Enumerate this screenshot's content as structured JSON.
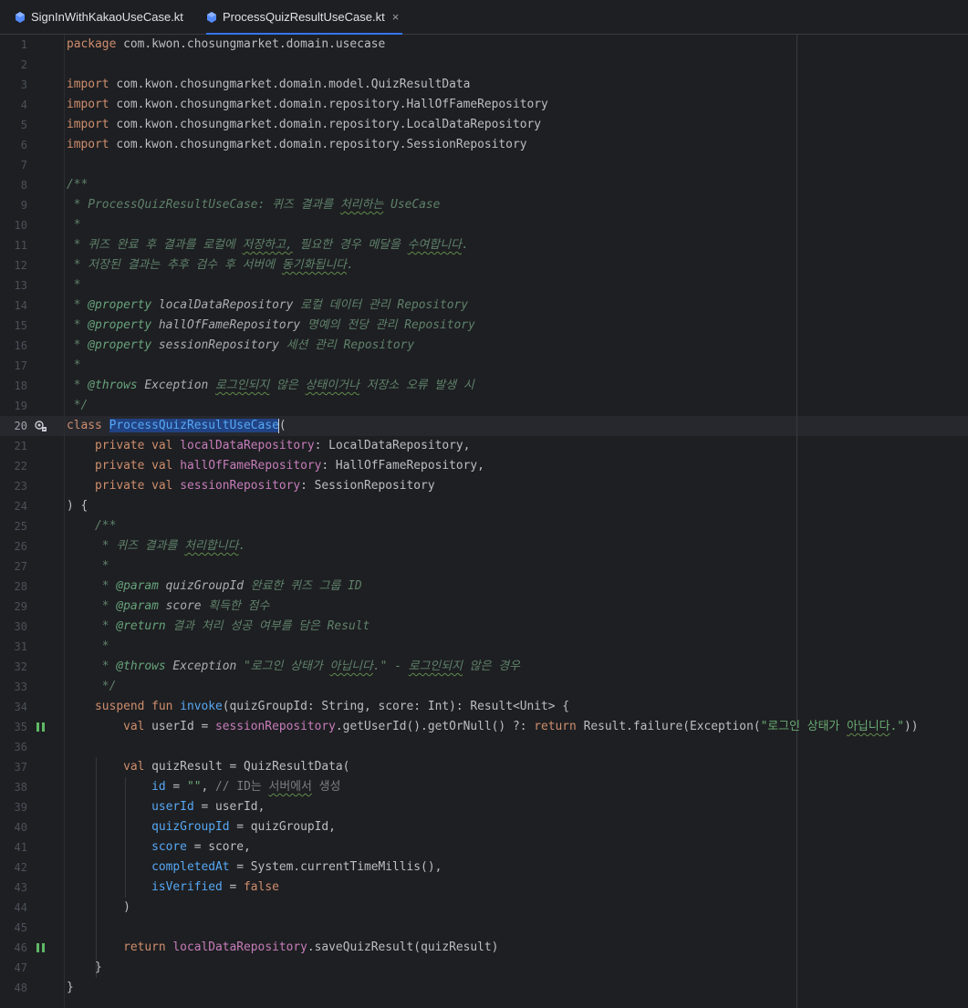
{
  "tabs": [
    {
      "label": "SignInWithKakaoUseCase.kt",
      "icon": "kotlin-file-icon",
      "active": false
    },
    {
      "label": "ProcessQuizResultUseCase.kt",
      "icon": "kotlin-file-icon",
      "active": true,
      "close": "×"
    }
  ],
  "line_numbers": [
    "1",
    "2",
    "3",
    "4",
    "5",
    "6",
    "7",
    "8",
    "9",
    "10",
    "11",
    "12",
    "13",
    "14",
    "15",
    "16",
    "17",
    "18",
    "19",
    "20",
    "21",
    "22",
    "23",
    "24",
    "25",
    "26",
    "27",
    "28",
    "29",
    "30",
    "31",
    "32",
    "33",
    "34",
    "35",
    "36",
    "37",
    "38",
    "39",
    "40",
    "41",
    "42",
    "43",
    "44",
    "45",
    "46",
    "47",
    "48"
  ],
  "code": {
    "l1a": "package",
    "l1b": " com.kwon.chosungmarket.domain.usecase",
    "l3a": "import",
    "l3b": " com.kwon.chosungmarket.domain.model.QuizResultData",
    "l4a": "import",
    "l4b": " com.kwon.chosungmarket.domain.repository.HallOfFameRepository",
    "l5a": "import",
    "l5b": " com.kwon.chosungmarket.domain.repository.LocalDataRepository",
    "l6a": "import",
    "l6b": " com.kwon.chosungmarket.domain.repository.SessionRepository",
    "l8": "/**",
    "l9a": " * ProcessQuizResultUseCase: 퀴즈 결과를 ",
    "l9b": "처리하는",
    "l9c": " UseCase",
    "l10": " *",
    "l11a": " * 퀴즈 완료 후 결과를 로컬에 ",
    "l11b": "저장하고,",
    "l11c": " 필요한 경우 메달을 ",
    "l11d": "수여합니다",
    "l11e": ".",
    "l12a": " * 저장된 결과는 추후 검수 후 서버에 ",
    "l12b": "동기화됩니다",
    "l12c": ".",
    "l13": " *",
    "l14a": " * ",
    "l14b": "@property",
    "l14c": " localDataRepository",
    "l14d": " 로컬 데이터 관리 Repository",
    "l15a": " * ",
    "l15b": "@property",
    "l15c": " hallOfFameRepository",
    "l15d": " 명예의 전당 관리 Repository",
    "l16a": " * ",
    "l16b": "@property",
    "l16c": " sessionRepository",
    "l16d": " 세션 관리 Repository",
    "l17": " *",
    "l18a": " * ",
    "l18b": "@throws",
    "l18c": " Exception",
    "l18d": " ",
    "l18e": "로그인되지",
    "l18f": " 않은 ",
    "l18g": "상태이거나",
    "l18h": " 저장소 오류 발생 시",
    "l19": " */",
    "l20a": "class",
    "l20b": " ",
    "l20c": "ProcessQuizResultUseCase",
    "l20d": "(",
    "l21a": "    private val ",
    "l21b": "localDataRepository",
    "l21c": ": LocalDataRepository,",
    "l22a": "    private val ",
    "l22b": "hallOfFameRepository",
    "l22c": ": HallOfFameRepository,",
    "l23a": "    private val ",
    "l23b": "sessionRepository",
    "l23c": ": SessionRepository",
    "l24": ") {",
    "l25": "    /**",
    "l26a": "     * 퀴즈 결과를 ",
    "l26b": "처리합니다",
    "l26c": ".",
    "l27": "     *",
    "l28a": "     * ",
    "l28b": "@param",
    "l28c": " quizGroupId",
    "l28d": " 완료한 퀴즈 그룹 ID",
    "l29a": "     * ",
    "l29b": "@param",
    "l29c": " score",
    "l29d": " 획득한 점수",
    "l30a": "     * ",
    "l30b": "@return",
    "l30c": " 결과 처리 성공 여부를 담은 Result",
    "l31": "     *",
    "l32a": "     * ",
    "l32b": "@throws",
    "l32c": " Exception",
    "l32d": " \"로그인 상태가 ",
    "l32e": "아닙니다",
    "l32f": ".\" - ",
    "l32g": "로그인되지",
    "l32h": " 않은 경우",
    "l33": "     */",
    "l34a": "    suspend fun ",
    "l34b": "invoke",
    "l34c": "(quizGroupId: String, score: Int): Result<Unit> {",
    "l35a": "        val",
    "l35b": " userId = ",
    "l35c": "sessionRepository",
    "l35d": ".getUserId().getOrNull() ?: ",
    "l35e": "return",
    "l35f": " Result.failure(Exception(",
    "l35g": "\"로그인 상태가 ",
    "l35h": "아닙니다",
    "l35i": ".\"",
    "l35j": "))",
    "l37a": "        val",
    "l37b": " quizResult = QuizResultData(",
    "l38a": "            ",
    "l38b": "id",
    "l38c": " = ",
    "l38d": "\"\"",
    "l38e": ", ",
    "l38f": "// ID는 ",
    "l38g": "서버에서",
    "l38h": " 생성",
    "l39a": "            ",
    "l39b": "userId",
    "l39c": " = userId,",
    "l40a": "            ",
    "l40b": "quizGroupId",
    "l40c": " = quizGroupId,",
    "l41a": "            ",
    "l41b": "score",
    "l41c": " = score,",
    "l42a": "            ",
    "l42b": "completedAt",
    "l42c": " = System.currentTimeMillis(),",
    "l43a": "            ",
    "l43b": "isVerified",
    "l43c": " = ",
    "l43d": "false",
    "l44": "        )",
    "l46a": "        return",
    "l46b": " ",
    "l46c": "localDataRepository",
    "l46d": ".saveQuizResult(quizResult)",
    "l47": "    }",
    "l48": "}"
  },
  "gutter_icons": {
    "line20": "implement-interface-icon",
    "line35": "suspend-call-icon",
    "line46": "suspend-call-icon"
  },
  "colors": {
    "background": "#1e1f22",
    "keyword": "#cf8e6d",
    "doc_comment": "#5f826b",
    "property": "#c77dbb",
    "function": "#56a8f5",
    "string": "#6aab73",
    "selection": "#214283"
  }
}
